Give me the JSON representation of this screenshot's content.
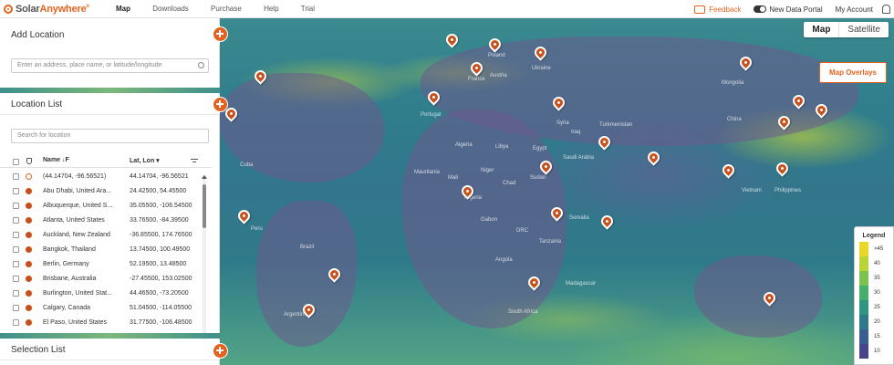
{
  "brand": {
    "name_part1": "Solar",
    "name_part2": "Anywhere",
    "reg": "®"
  },
  "nav": [
    "Map",
    "Downloads",
    "Purchase",
    "Help",
    "Trial"
  ],
  "topright": {
    "feedback": "Feedback",
    "portal": "New Data Portal",
    "account": "My Account"
  },
  "panel": {
    "add_location": "Add Location",
    "address_placeholder": "Enter an address, place name, or latitude/longitude",
    "location_list": "Location List",
    "search_placeholder": "Search for location",
    "selection_list": "Selection List",
    "columns": {
      "name": "Name",
      "latlon": "Lat, Lon"
    },
    "rows": [
      {
        "name": "(44.14704, -96.56521)",
        "latlon": "44.14704, -96.56521",
        "hollow": true
      },
      {
        "name": "Abu Dhabi, United Ara...",
        "latlon": "24.42500, 54.45500"
      },
      {
        "name": "Albuquerque, United S...",
        "latlon": "35.05500, -106.54500"
      },
      {
        "name": "Atlanta, United States",
        "latlon": "33.76500, -84.39500"
      },
      {
        "name": "Auckland, New Zealand",
        "latlon": "-36.85500, 174.76500"
      },
      {
        "name": "Bangkok, Thailand",
        "latlon": "13.74500, 100.49500"
      },
      {
        "name": "Berlin, Germany",
        "latlon": "52.19500, 13.48500"
      },
      {
        "name": "Brisbane, Australia",
        "latlon": "-27.45500, 153.02500"
      },
      {
        "name": "Burlington, United Stat...",
        "latlon": "44.46500, -73.20500"
      },
      {
        "name": "Calgary, Canada",
        "latlon": "51.04500, -114.05500"
      },
      {
        "name": "El Paso, United States",
        "latlon": "31.77500, -106.48500"
      }
    ]
  },
  "map": {
    "toggle_map": "Map",
    "toggle_satellite": "Satellite",
    "overlays_button": "Map Overlays",
    "labels": [
      "Poland",
      "Ukraine",
      "France",
      "Portugal",
      "Austria",
      "Mongolia",
      "China",
      "Algeria",
      "Libya",
      "Egypt",
      "Saudi Arabia",
      "Turkmenistan",
      "Mauritania",
      "Mali",
      "Niger",
      "Chad",
      "Sudan",
      "Nigeria",
      "Gabon",
      "DRC",
      "Tanzania",
      "Angola",
      "Somalia",
      "Madagascar",
      "South Africa",
      "Cuba",
      "Brazil",
      "Argentina",
      "Peru",
      "Vietnam",
      "Philippines",
      "Syria",
      "Iraq"
    ],
    "legend": {
      "title": "Legend",
      "items": [
        {
          "label": ">45",
          "color": "#e9d72a"
        },
        {
          "label": "40",
          "color": "#b9d437"
        },
        {
          "label": "35",
          "color": "#7cc24e"
        },
        {
          "label": "30",
          "color": "#46ad6a"
        },
        {
          "label": "25",
          "color": "#2f9480"
        },
        {
          "label": "20",
          "color": "#2f7a8a"
        },
        {
          "label": "15",
          "color": "#3a5f8f"
        },
        {
          "label": "10",
          "color": "#47468b"
        }
      ]
    }
  }
}
